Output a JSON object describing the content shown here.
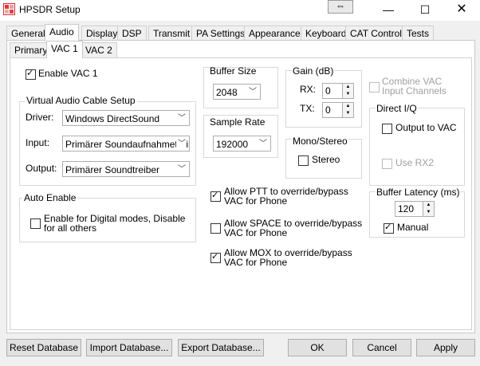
{
  "window": {
    "title": "HPSDR Setup",
    "icon": "app-icon",
    "restore_glyph": "⇔"
  },
  "main_tabs": [
    "General",
    "Audio",
    "Display",
    "DSP",
    "Transmit",
    "PA Settings",
    "Appearance",
    "Keyboard",
    "CAT Control",
    "Tests"
  ],
  "sub_tabs": [
    "Primary",
    "VAC 1",
    "VAC 2"
  ],
  "enable_vac1": {
    "label": "Enable VAC 1",
    "checked": true
  },
  "vac_setup": {
    "title": "Virtual Audio Cable Setup",
    "driver_label": "Driver:",
    "driver_value": "Windows DirectSound",
    "input_label": "Input:",
    "input_value": "Primärer Soundaufnahmetreiber",
    "output_label": "Output:",
    "output_value": "Primärer Soundtreiber"
  },
  "auto_enable": {
    "title": "Auto Enable",
    "label_line1": "Enable for Digital modes, Disable",
    "label_line2": "for all others",
    "checked": false
  },
  "buffer_size": {
    "title": "Buffer Size",
    "value": "2048"
  },
  "sample_rate": {
    "title": "Sample Rate",
    "value": "192000"
  },
  "gain": {
    "title": "Gain (dB)",
    "rx_label": "RX:",
    "rx_value": "0",
    "tx_label": "TX:",
    "tx_value": "0"
  },
  "mono_stereo": {
    "title": "Mono/Stereo",
    "stereo_label": "Stereo",
    "checked": false
  },
  "combine_vac": {
    "line1": "Combine VAC",
    "line2": "Input Channels",
    "checked": false
  },
  "direct_iq": {
    "title": "Direct I/Q",
    "output_label": "Output to VAC",
    "use_rx2_label": "Use RX2"
  },
  "buffer_latency": {
    "title": "Buffer Latency (ms)",
    "value": "120",
    "manual_label": "Manual",
    "manual_checked": true
  },
  "allow_ptt": {
    "line1": "Allow PTT to override/bypass",
    "line2": "VAC for Phone",
    "checked": true
  },
  "allow_space": {
    "line1": "Allow SPACE to override/bypass",
    "line2": "VAC for Phone",
    "checked": false
  },
  "allow_mox": {
    "line1": "Allow MOX to override/bypass",
    "line2": "VAC for Phone",
    "checked": true
  },
  "buttons": {
    "reset": "Reset Database",
    "import": "Import Database...",
    "export": "Export Database...",
    "ok": "OK",
    "cancel": "Cancel",
    "apply": "Apply"
  }
}
